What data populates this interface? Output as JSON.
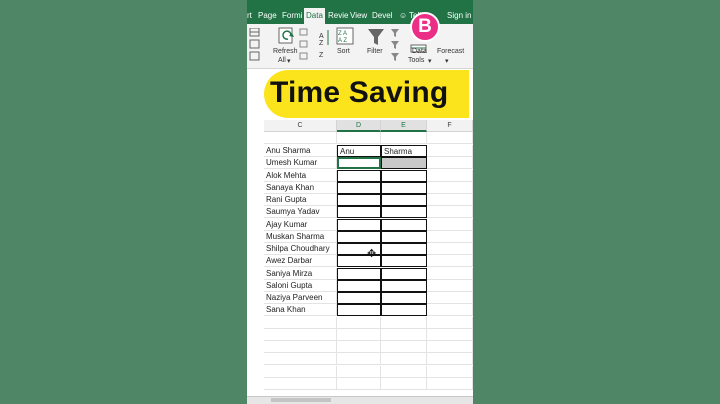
{
  "ribbon": {
    "tabs": [
      "rt",
      "Page",
      "Formi",
      "Data",
      "Revie",
      "View",
      "Devel"
    ],
    "active_tab": "Data",
    "tell_me": "Tell",
    "sign_in": "Sign in",
    "refresh_label_1": "Refresh",
    "refresh_label_2": "All",
    "sort_label": "Sort",
    "filter_label": "Filter",
    "data_tools_1": "Data",
    "data_tools_2": "Tools",
    "forecast_label": "Forecast"
  },
  "brand": {
    "letter": "B",
    "color": "#ec2f86"
  },
  "overlay": {
    "text": "Time Saving",
    "bg": "#fce41c"
  },
  "sheet": {
    "columns": [
      "C",
      "D",
      "E",
      "F"
    ],
    "header_row": [
      "Anu Sharma",
      "Anu",
      "Sharma"
    ],
    "names": [
      "Umesh Kumar",
      "Alok Mehta",
      "Sanaya Khan",
      "Rani Gupta",
      "Saumya Yadav",
      "Ajay Kumar",
      "Muskan Sharma",
      "Shilpa Choudhary",
      "Awez Darbar",
      "Saniya Mirza",
      "Saloni Gupta",
      "Naziya Parveen",
      "Sana Khan"
    ]
  },
  "colors": {
    "excel_green": "#217346",
    "background": "#4f8766"
  }
}
